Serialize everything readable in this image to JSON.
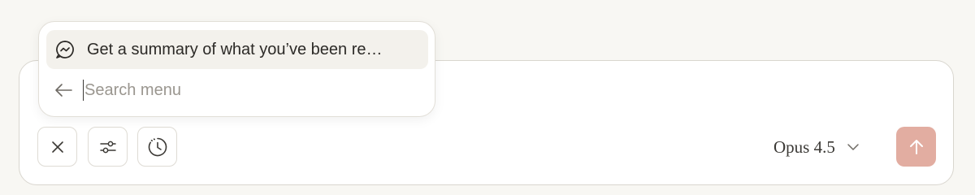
{
  "popup": {
    "menu_item_label": "Get a summary of what you’ve been re…",
    "search_placeholder": "Search menu",
    "search_value": ""
  },
  "toolbar": {
    "close_icon": "close-icon",
    "settings_icon": "sliders-icon",
    "history_icon": "history-clock-icon"
  },
  "model_selector": {
    "selected": "Opus 4.5"
  },
  "send_button": {
    "icon": "arrow-up-icon"
  },
  "colors": {
    "background": "#f8f7f3",
    "send_button": "#e2ada1",
    "menu_item_highlight": "#f3f1ec"
  }
}
